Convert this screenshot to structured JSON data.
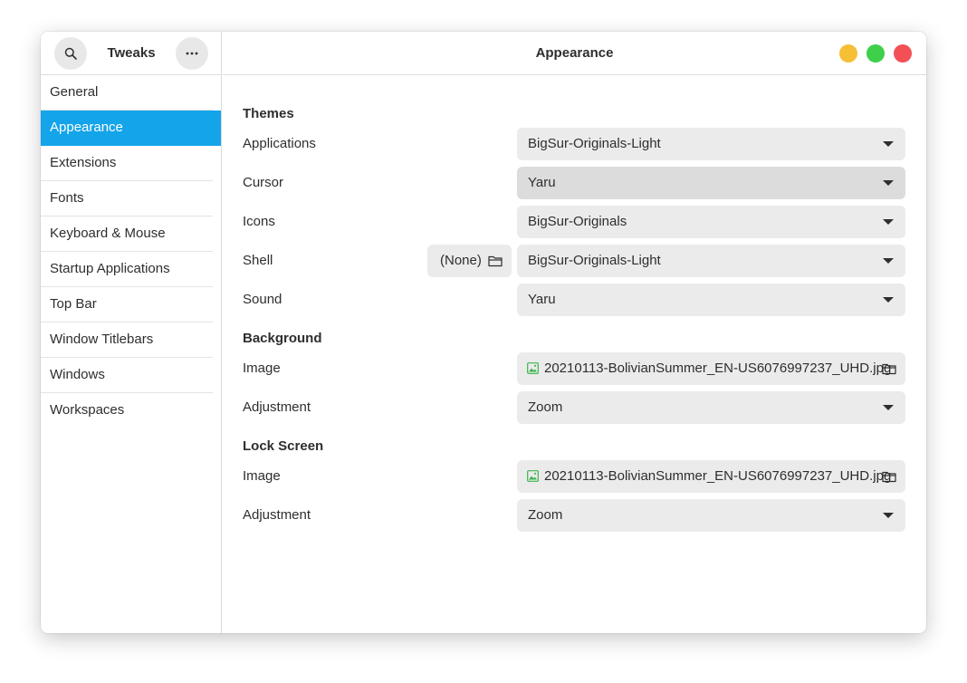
{
  "sidebar": {
    "title": "Tweaks",
    "search_icon": "search-icon",
    "menu_icon": "more-horizontal-icon",
    "items": [
      {
        "label": "General"
      },
      {
        "label": "Appearance",
        "active": true
      },
      {
        "label": "Extensions"
      },
      {
        "label": "Fonts"
      },
      {
        "label": "Keyboard & Mouse"
      },
      {
        "label": "Startup Applications"
      },
      {
        "label": "Top Bar"
      },
      {
        "label": "Window Titlebars"
      },
      {
        "label": "Windows"
      },
      {
        "label": "Workspaces"
      }
    ]
  },
  "header": {
    "title": "Appearance"
  },
  "themes": {
    "title": "Themes",
    "applications": {
      "label": "Applications",
      "value": "BigSur-Originals-Light"
    },
    "cursor": {
      "label": "Cursor",
      "value": "Yaru"
    },
    "icons": {
      "label": "Icons",
      "value": "BigSur-Originals"
    },
    "shell": {
      "label": "Shell",
      "file_value": "(None)",
      "value": "BigSur-Originals-Light"
    },
    "sound": {
      "label": "Sound",
      "value": "Yaru"
    }
  },
  "background": {
    "title": "Background",
    "image": {
      "label": "Image",
      "value": "20210113-BolivianSummer_EN-US6076997237_UHD.jpg"
    },
    "adjustment": {
      "label": "Adjustment",
      "value": "Zoom"
    }
  },
  "lock_screen": {
    "title": "Lock Screen",
    "image": {
      "label": "Image",
      "value": "20210113-BolivianSummer_EN-US6076997237_UHD.jpg"
    },
    "adjustment": {
      "label": "Adjustment",
      "value": "Zoom"
    }
  },
  "colors": {
    "accent": "#14a4ea",
    "minimize": "#f6c036",
    "maximize": "#3ed04b",
    "close": "#f25056"
  }
}
